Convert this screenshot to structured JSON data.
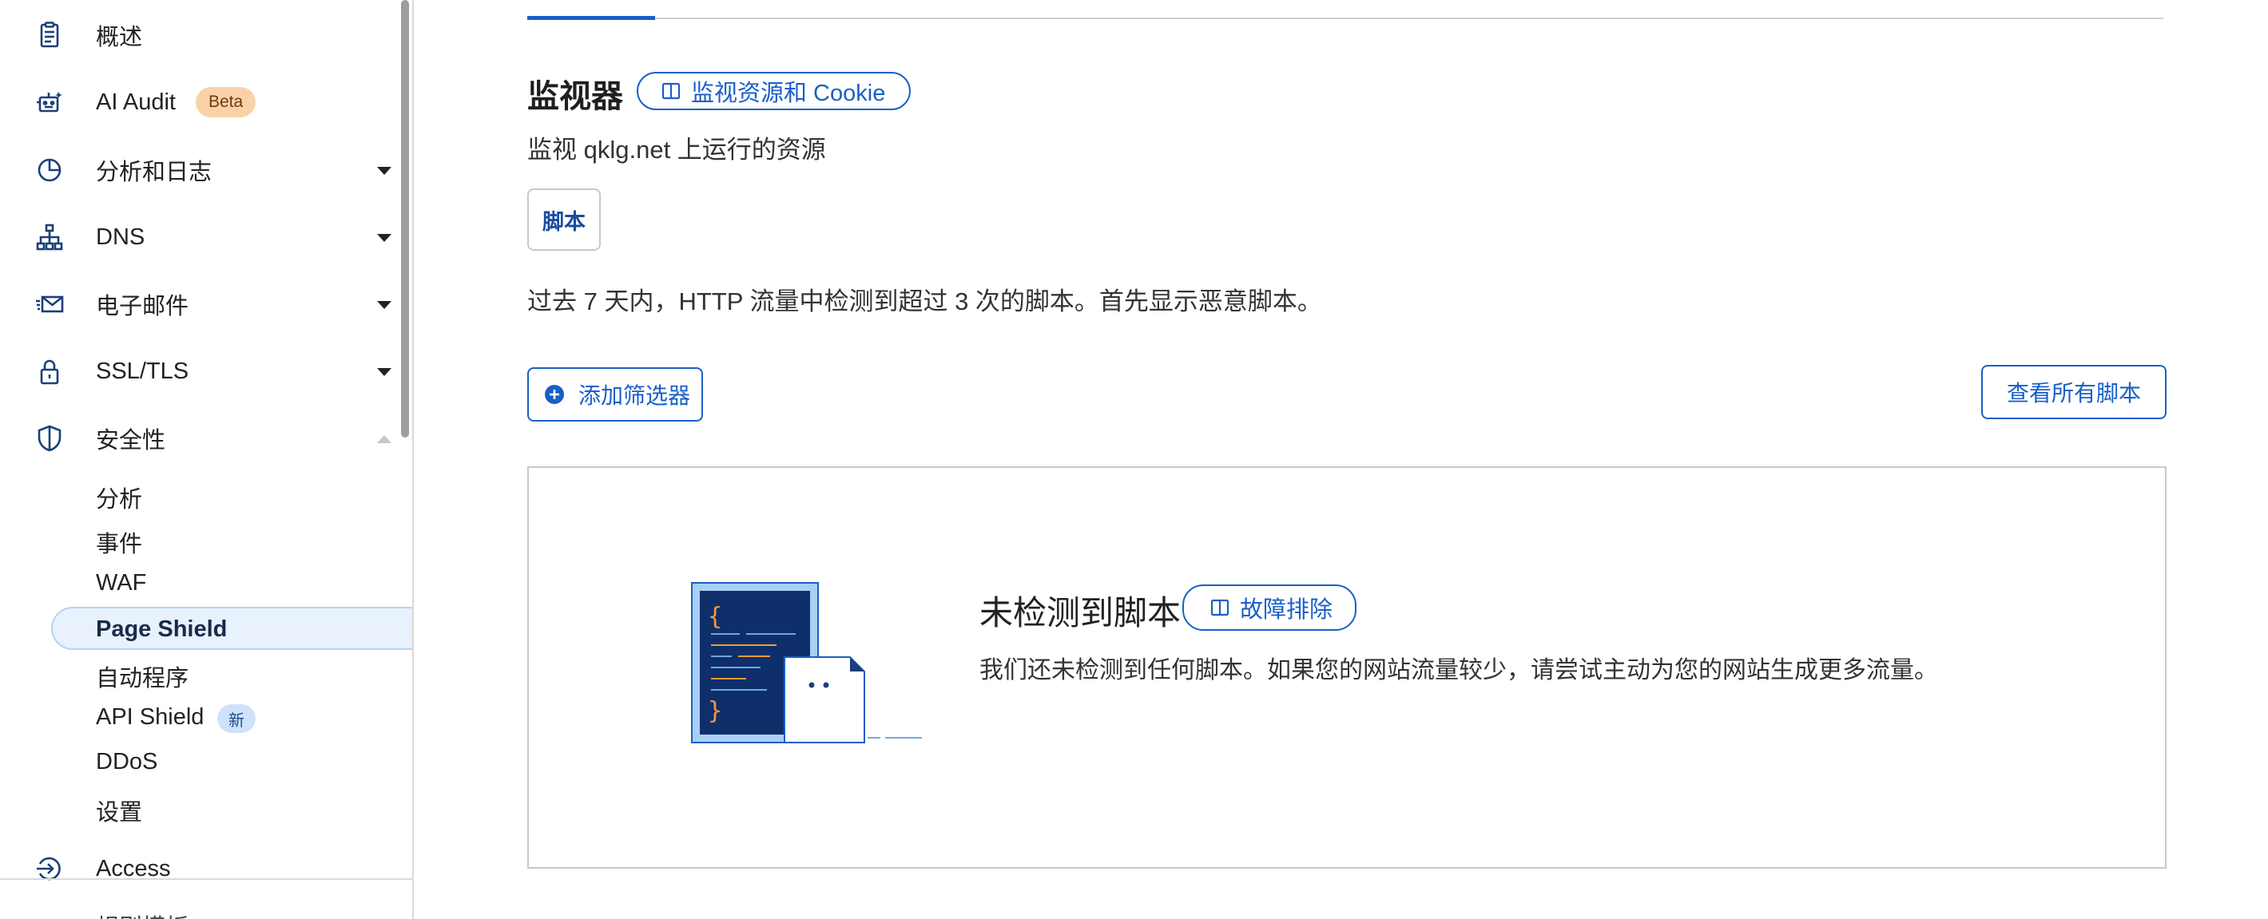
{
  "sidebar": {
    "items": [
      {
        "label": "概述",
        "icon": "clipboard-icon"
      },
      {
        "label": "AI Audit",
        "icon": "robot-icon",
        "badge": "Beta"
      },
      {
        "label": "分析和日志",
        "icon": "pie-chart-icon"
      },
      {
        "label": "DNS",
        "icon": "network-icon"
      },
      {
        "label": "电子邮件",
        "icon": "email-icon"
      },
      {
        "label": "SSL/TLS",
        "icon": "lock-icon"
      },
      {
        "label": "安全性",
        "icon": "shield-icon"
      }
    ],
    "security_subitems": [
      {
        "label": "分析"
      },
      {
        "label": "事件"
      },
      {
        "label": "WAF"
      },
      {
        "label": "Page Shield",
        "active": true
      },
      {
        "label": "自动程序"
      },
      {
        "label": "API Shield",
        "badge": "新"
      },
      {
        "label": "DDoS"
      },
      {
        "label": "设置"
      }
    ],
    "bottom_item": {
      "label": "Access",
      "icon": "access-icon"
    },
    "cut_off_item": {
      "label": "规则模板"
    }
  },
  "main": {
    "section_title": "监视器",
    "doc_link_label": "监视资源和 Cookie",
    "subtitle": "监视 qklg.net 上运行的资源",
    "tab_label": "脚本",
    "description": "过去 7 天内，HTTP 流量中检测到超过 3 次的脚本。首先显示恶意脚本。",
    "add_filter_label": "添加筛选器",
    "view_all_label": "查看所有脚本",
    "empty_state": {
      "title": "未检测到脚本",
      "troubleshoot_label": "故障排除",
      "message": "我们还未检测到任何脚本。如果您的网站流量较少，请尝试主动为您的网站生成更多流量。"
    }
  },
  "colors": {
    "accent": "#1a5fc8",
    "sidebar_active_bg": "#e8f1fc",
    "beta_badge_bg": "#fbd2a8",
    "new_badge_bg": "#cfe2fb",
    "illustration_navy": "#0f2f6b",
    "illustration_orange": "#f39a3c"
  }
}
